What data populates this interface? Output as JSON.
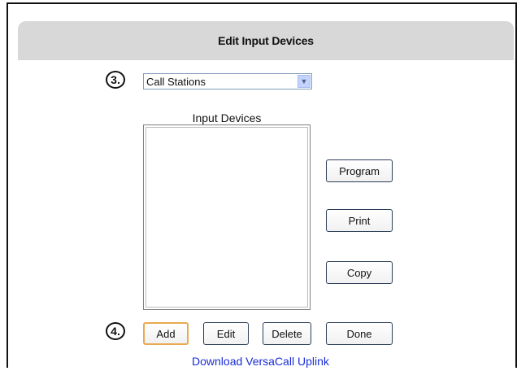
{
  "title": "Edit Input Devices",
  "steps": {
    "step3": "3.",
    "step4": "4."
  },
  "device_type": {
    "selected": "Call Stations"
  },
  "input_devices": {
    "label": "Input Devices",
    "items": []
  },
  "buttons": {
    "program": "Program",
    "print": "Print",
    "copy": "Copy",
    "add": "Add",
    "edit": "Edit",
    "delete": "Delete",
    "done": "Done"
  },
  "download_link": "Download VersaCall Uplink",
  "colors": {
    "header_bg": "#d8d8d8",
    "link": "#1a2dd6",
    "default_button_border": "#e8a94f"
  }
}
